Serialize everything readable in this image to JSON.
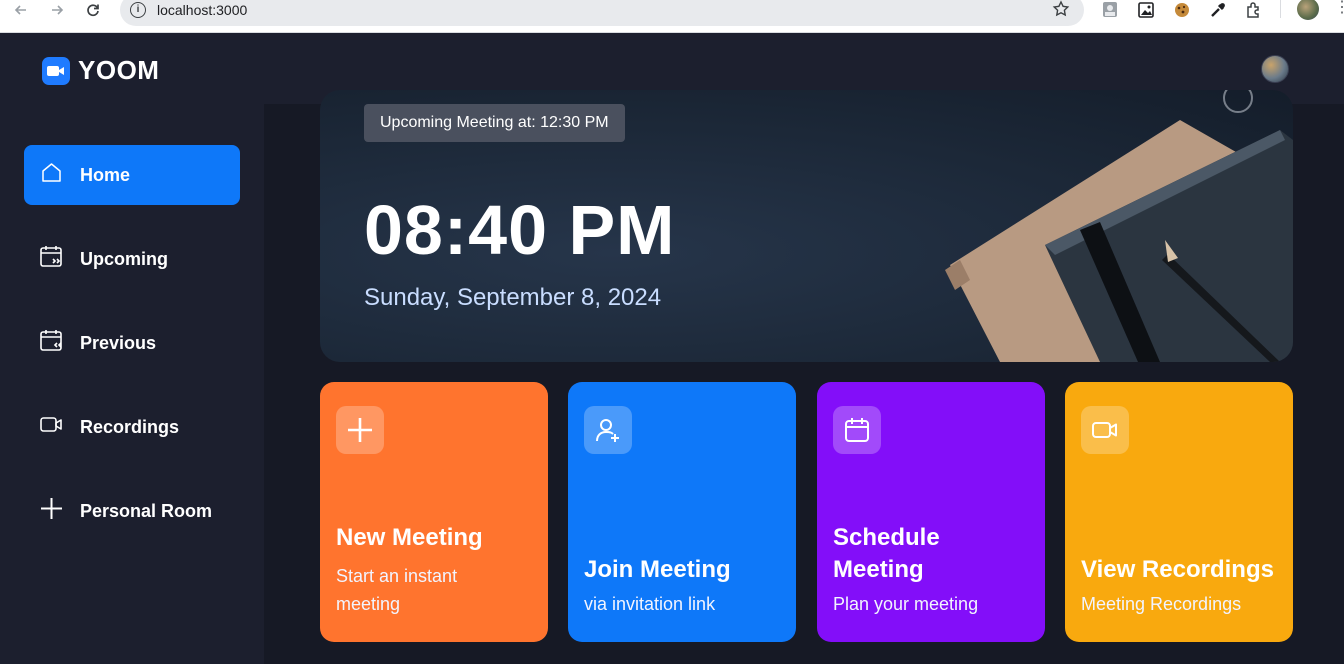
{
  "browser": {
    "url": "localhost:3000"
  },
  "app": {
    "name": "YOOM"
  },
  "sidebar": {
    "items": [
      {
        "label": "Home",
        "icon": "home-icon",
        "active": true
      },
      {
        "label": "Upcoming",
        "icon": "calendar-forward-icon",
        "active": false
      },
      {
        "label": "Previous",
        "icon": "calendar-back-icon",
        "active": false
      },
      {
        "label": "Recordings",
        "icon": "video-icon",
        "active": false
      },
      {
        "label": "Personal Room",
        "icon": "plus-icon",
        "active": false
      }
    ]
  },
  "hero": {
    "upcoming": "Upcoming Meeting at: 12:30 PM",
    "time": "08:40 PM",
    "date": "Sunday, September 8, 2024"
  },
  "cards": [
    {
      "title": "New Meeting",
      "subtitle": "Start an instant meeting",
      "icon": "plus-icon",
      "color": "#ff742e"
    },
    {
      "title": "Join Meeting",
      "subtitle": "via invitation link",
      "icon": "add-user-icon",
      "color": "#0e78f9"
    },
    {
      "title": "Schedule Meeting",
      "subtitle": "Plan your meeting",
      "icon": "calendar-icon",
      "color": "#830ef9"
    },
    {
      "title": "View Recordings",
      "subtitle": "Meeting Recordings",
      "icon": "video-icon",
      "color": "#f9a90e"
    }
  ],
  "colors": {
    "accent": "#0e78f9",
    "background": "#161925",
    "panel": "#1c1f2e"
  }
}
